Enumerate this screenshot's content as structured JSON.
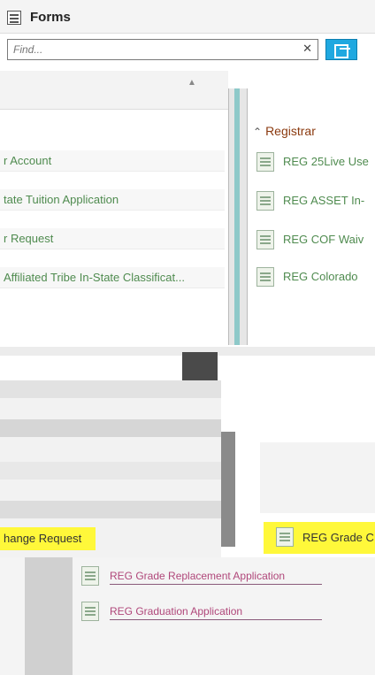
{
  "header": {
    "title": "Forms",
    "icon": "forms-icon"
  },
  "search": {
    "placeholder": "Find...",
    "filter_icon": "filter-icon"
  },
  "left_list": {
    "items": [
      {
        "label": "r Account"
      },
      {
        "label": "tate Tuition Application"
      },
      {
        "label": "r Request"
      },
      {
        "label": "Affiliated Tribe In-State Classificat..."
      }
    ]
  },
  "registrar": {
    "heading": "Registrar",
    "items": [
      {
        "label": "REG 25Live Use"
      },
      {
        "label": "REG ASSET In-"
      },
      {
        "label": "REG COF Waiv"
      },
      {
        "label": "REG Colorado"
      }
    ]
  },
  "highlighted": {
    "left_label": "hange Request",
    "right_label": "REG Grade C"
  },
  "bottom_list": {
    "items": [
      {
        "label": "REG Grade Replacement Application"
      },
      {
        "label": "REG Graduation Application"
      }
    ]
  },
  "colors": {
    "highlight": "#fff83a",
    "accent": "#1fa8e0",
    "link_green": "#4f8b4f",
    "section_heading": "#8b3a0f"
  }
}
